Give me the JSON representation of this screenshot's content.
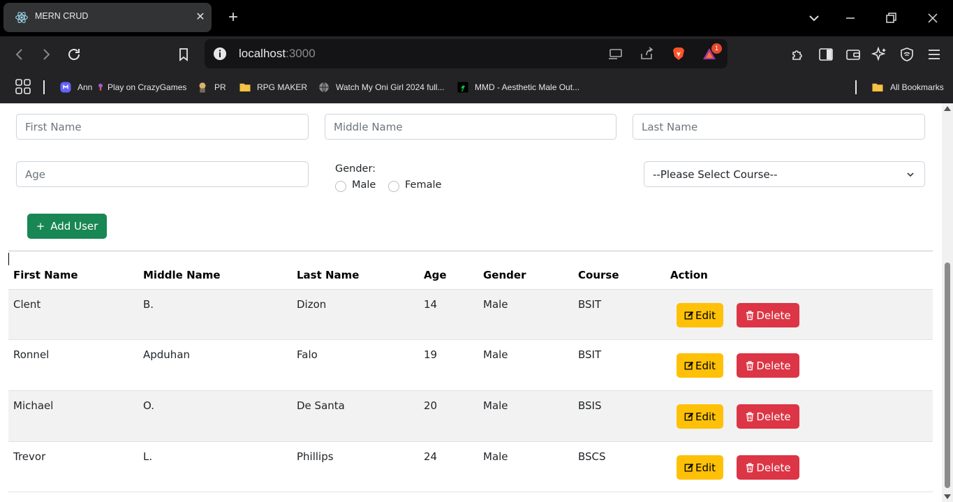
{
  "browser": {
    "tab_title": "MERN CRUD",
    "url_host": "localhost",
    "url_port": ":3000",
    "brave_rewards_badge": "1",
    "bookmarks": [
      {
        "label": "Ann",
        "icon": "mastodon-icon"
      },
      {
        "label": "Play on CrazyGames",
        "icon": "crazygames-icon"
      },
      {
        "label": "PR",
        "icon": "pr-avatar-icon"
      },
      {
        "label": "RPG MAKER",
        "icon": "folder-icon"
      },
      {
        "label": "Watch My Oni Girl 2024 full...",
        "icon": "globe-icon"
      },
      {
        "label": "MMD - Aesthetic Male Out...",
        "icon": "deviantart-icon"
      }
    ],
    "all_bookmarks_label": "All Bookmarks"
  },
  "form": {
    "first_name_placeholder": "First Name",
    "middle_name_placeholder": "Middle Name",
    "last_name_placeholder": "Last Name",
    "age_placeholder": "Age",
    "gender_label": "Gender:",
    "gender_options": [
      "Male",
      "Female"
    ],
    "course_selected": "--Please Select Course--",
    "add_button_icon": "+",
    "add_button_label": "Add User"
  },
  "table": {
    "headers": [
      "First Name",
      "Middle Name",
      "Last Name",
      "Age",
      "Gender",
      "Course",
      "Action"
    ],
    "rows": [
      {
        "first": "Clent",
        "middle": "B.",
        "last": "Dizon",
        "age": "14",
        "gender": "Male",
        "course": "BSIT"
      },
      {
        "first": "Ronnel",
        "middle": "Apduhan",
        "last": "Falo",
        "age": "19",
        "gender": "Male",
        "course": "BSIT"
      },
      {
        "first": "Michael",
        "middle": "O.",
        "last": "De Santa",
        "age": "20",
        "gender": "Male",
        "course": "BSIS"
      },
      {
        "first": "Trevor",
        "middle": "L.",
        "last": "Phillips",
        "age": "24",
        "gender": "Male",
        "course": "BSCS"
      }
    ],
    "edit_label": "Edit",
    "delete_label": "Delete"
  },
  "colors": {
    "success": "#198754",
    "warning": "#ffc107",
    "danger": "#dc3545",
    "stripe": "#f2f2f2"
  }
}
